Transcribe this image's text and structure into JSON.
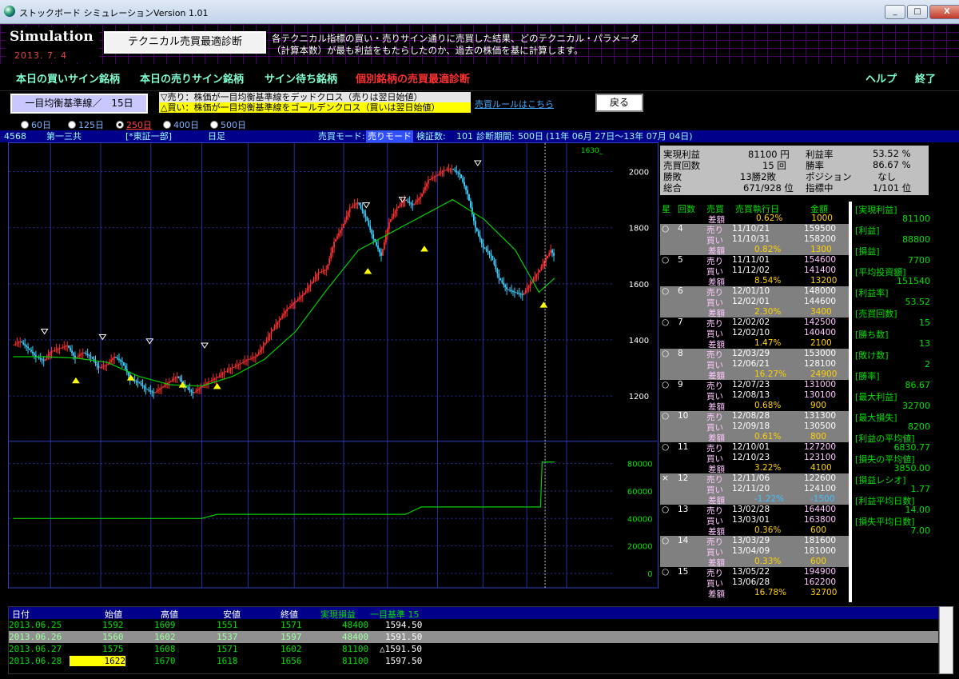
{
  "window": {
    "title": "ストックボード シミュレーションVersion 1.01",
    "min": "_",
    "max": "□",
    "close": "X"
  },
  "banner": {
    "logo": "Simulation",
    "date": "2013. 7. 4",
    "diag_button": "テクニカル売買最適診断",
    "description": "各テクニカル指標の買い・売りサイン通りに売買した結果、どのテクニカル・パラメータ（計算本数）が最も利益をもたらしたのか、過去の株価を基に計算します。"
  },
  "nav": {
    "buy": "本日の買いサイン銘柄",
    "sell": "本日の売りサイン銘柄",
    "wait": "サイン待ち銘柄",
    "optimal": "個別銘柄の売買最適診断",
    "help": "ヘルプ",
    "exit": "終了"
  },
  "tools": {
    "indicator": "一目均衡基準線／　15日",
    "sell_rule": "▽売り：株価が一目均衡基準線をデッドクロス（売りは翌日始値）",
    "buy_rule": "△買い：株価が一目均衡基準線をゴールデンクロス（買いは翌日始値）",
    "rule_link": "売買ルールはこちら",
    "back": "戻る"
  },
  "periods": [
    "60日",
    "125日",
    "250日",
    "400日",
    "500日"
  ],
  "selected_period": "250日",
  "info": {
    "code": "4568",
    "name": "第一三共",
    "market": "[*東証一部]",
    "ashi": "日足",
    "mode_label": "売買モード:",
    "mode": "売りモード",
    "count_label": "検証数:",
    "count": "101",
    "period_label": "診断期間:",
    "period": "500日",
    "range": "(11年 06月 27日～13年 07月 04日)"
  },
  "stats": {
    "jitsugen_label": "実現利益",
    "jitsugen": "81100 円",
    "rieki_rate_label": "利益率",
    "rieki_rate": "53.52 %",
    "count_label": "売買回数",
    "count": "15 回",
    "win_rate_label": "勝率",
    "win_rate": "86.67 %",
    "wl_label": "勝敗",
    "wl": "13勝2敗",
    "pos_label": "ポジション",
    "pos": "なし",
    "total_label": "総合",
    "total": "671/928 位",
    "index_label": "指標中",
    "index": "1/101 位"
  },
  "trade_header": {
    "star": "星",
    "no": "回数",
    "side": "売買",
    "date": "売買執行日",
    "amount": "金額"
  },
  "first_diff": {
    "label": "差額",
    "pct": "0.62%",
    "amt": "1000"
  },
  "trades": [
    {
      "mark": "○",
      "no": "4",
      "sell_date": "11/10/21",
      "sell_amt": "159500",
      "buy_date": "11/10/31",
      "buy_amt": "158200",
      "pct": "0.82%",
      "diff": "1300"
    },
    {
      "mark": "○",
      "no": "5",
      "sell_date": "11/11/01",
      "sell_amt": "154600",
      "buy_date": "11/12/02",
      "buy_amt": "141400",
      "pct": "8.54%",
      "diff": "13200"
    },
    {
      "mark": "○",
      "no": "6",
      "sell_date": "12/01/10",
      "sell_amt": "148000",
      "buy_date": "12/02/01",
      "buy_amt": "144600",
      "pct": "2.30%",
      "diff": "3400"
    },
    {
      "mark": "○",
      "no": "7",
      "sell_date": "12/02/02",
      "sell_amt": "142500",
      "buy_date": "12/02/10",
      "buy_amt": "140400",
      "pct": "1.47%",
      "diff": "2100"
    },
    {
      "mark": "○",
      "no": "8",
      "sell_date": "12/03/29",
      "sell_amt": "153000",
      "buy_date": "12/06/21",
      "buy_amt": "128100",
      "pct": "16.27%",
      "diff": "24900"
    },
    {
      "mark": "○",
      "no": "9",
      "sell_date": "12/07/23",
      "sell_amt": "131000",
      "buy_date": "12/08/13",
      "buy_amt": "130100",
      "pct": "0.68%",
      "diff": "900"
    },
    {
      "mark": "○",
      "no": "10",
      "sell_date": "12/08/28",
      "sell_amt": "131300",
      "buy_date": "12/09/18",
      "buy_amt": "130500",
      "pct": "0.61%",
      "diff": "800"
    },
    {
      "mark": "○",
      "no": "11",
      "sell_date": "12/10/01",
      "sell_amt": "127200",
      "buy_date": "12/10/23",
      "buy_amt": "123100",
      "pct": "3.22%",
      "diff": "4100"
    },
    {
      "mark": "×",
      "no": "12",
      "sell_date": "12/11/06",
      "sell_amt": "122600",
      "buy_date": "12/11/20",
      "buy_amt": "124100",
      "pct": "-1.22%",
      "diff": "-1500"
    },
    {
      "mark": "○",
      "no": "13",
      "sell_date": "13/02/28",
      "sell_amt": "164400",
      "buy_date": "13/03/01",
      "buy_amt": "163800",
      "pct": "0.36%",
      "diff": "600"
    },
    {
      "mark": "○",
      "no": "14",
      "sell_date": "13/03/29",
      "sell_amt": "181600",
      "buy_date": "13/04/09",
      "buy_amt": "181000",
      "pct": "0.33%",
      "diff": "600"
    },
    {
      "mark": "○",
      "no": "15",
      "sell_date": "13/05/22",
      "sell_amt": "194900",
      "buy_date": "13/06/28",
      "buy_amt": "162200",
      "pct": "16.78%",
      "diff": "32700"
    }
  ],
  "trade_words": {
    "sell": "売り",
    "buy": "買い",
    "diff": "差額"
  },
  "summary": [
    {
      "k": "[実現利益]",
      "v": "81100"
    },
    {
      "k": "[利益]",
      "v": "88800"
    },
    {
      "k": "[損益]",
      "v": "7700"
    },
    {
      "k": "[平均投資額]",
      "v": "151540"
    },
    {
      "k": "[利益率]",
      "v": "53.52"
    },
    {
      "k": "[売買回数]",
      "v": "15"
    },
    {
      "k": "[勝ち数]",
      "v": "13"
    },
    {
      "k": "[敗け数]",
      "v": "2"
    },
    {
      "k": "[勝率]",
      "v": "86.67"
    },
    {
      "k": "[最大利益]",
      "v": "32700"
    },
    {
      "k": "[最大損失]",
      "v": "8200"
    },
    {
      "k": "[利益の平均値]",
      "v": "6830.77"
    },
    {
      "k": "[損失の平均値]",
      "v": "3850.00"
    },
    {
      "k": "[損益レシオ]",
      "v": "1.77"
    },
    {
      "k": "[利益平均日数]",
      "v": "14.00"
    },
    {
      "k": "[損失平均日数]",
      "v": "7.00"
    }
  ],
  "table": {
    "headers": [
      "日付",
      "始値",
      "高値",
      "安値",
      "終値",
      "実現損益",
      "一目基準 15"
    ],
    "rows": [
      [
        "2013.06.25",
        "1592",
        "1609",
        "1551",
        "1571",
        "48400",
        "1594.50"
      ],
      [
        "2013.06.26",
        "1560",
        "1602",
        "1537",
        "1597",
        "48400",
        "1591.50"
      ],
      [
        "2013.06.27",
        "1575",
        "1608",
        "1571",
        "1602",
        "81100",
        "△1591.50"
      ],
      [
        "2013.06.28",
        "1622",
        "1670",
        "1618",
        "1656",
        "81100",
        "1597.50"
      ]
    ]
  },
  "chart_data": {
    "type": "candlestick",
    "price_axis": {
      "ticks": [
        "2000",
        "1800",
        "1600",
        "1400",
        "1200"
      ],
      "range": [
        1050,
        2090
      ]
    },
    "profit_axis": {
      "ticks": [
        "80000",
        "60000",
        "40000",
        "20000",
        "0"
      ],
      "range": [
        -3000,
        87000
      ]
    },
    "x_labels": [
      "7",
      "8",
      "9",
      "10",
      "11",
      "12",
      "13/1",
      "2",
      "3",
      "4",
      "5",
      "6",
      "7"
    ],
    "last_price_label": "1630_",
    "price_path": [
      [
        0,
        1380
      ],
      [
        5,
        1395
      ],
      [
        10,
        1370
      ],
      [
        15,
        1340
      ],
      [
        20,
        1325
      ],
      [
        25,
        1360
      ],
      [
        30,
        1370
      ],
      [
        35,
        1380
      ],
      [
        40,
        1335
      ],
      [
        45,
        1355
      ],
      [
        50,
        1340
      ],
      [
        55,
        1300
      ],
      [
        60,
        1310
      ],
      [
        65,
        1340
      ],
      [
        70,
        1320
      ],
      [
        75,
        1260
      ],
      [
        80,
        1250
      ],
      [
        85,
        1225
      ],
      [
        90,
        1210
      ],
      [
        95,
        1230
      ],
      [
        100,
        1250
      ],
      [
        105,
        1270
      ],
      [
        110,
        1235
      ],
      [
        115,
        1210
      ],
      [
        120,
        1230
      ],
      [
        125,
        1250
      ],
      [
        130,
        1265
      ],
      [
        135,
        1285
      ],
      [
        140,
        1300
      ],
      [
        145,
        1315
      ],
      [
        150,
        1330
      ],
      [
        155,
        1340
      ],
      [
        160,
        1380
      ],
      [
        165,
        1430
      ],
      [
        170,
        1470
      ],
      [
        175,
        1510
      ],
      [
        180,
        1535
      ],
      [
        185,
        1560
      ],
      [
        190,
        1600
      ],
      [
        195,
        1640
      ],
      [
        200,
        1650
      ],
      [
        205,
        1750
      ],
      [
        210,
        1800
      ],
      [
        215,
        1870
      ],
      [
        220,
        1890
      ],
      [
        225,
        1840
      ],
      [
        230,
        1760
      ],
      [
        235,
        1700
      ],
      [
        240,
        1820
      ],
      [
        245,
        1870
      ],
      [
        250,
        1900
      ],
      [
        255,
        1880
      ],
      [
        260,
        1910
      ],
      [
        265,
        1970
      ],
      [
        270,
        1985
      ],
      [
        275,
        2005
      ],
      [
        280,
        2010
      ],
      [
        285,
        1990
      ],
      [
        290,
        1920
      ],
      [
        295,
        1800
      ],
      [
        300,
        1730
      ],
      [
        305,
        1700
      ],
      [
        310,
        1620
      ],
      [
        315,
        1580
      ],
      [
        320,
        1570
      ],
      [
        325,
        1560
      ],
      [
        330,
        1600
      ],
      [
        335,
        1640
      ],
      [
        340,
        1690
      ],
      [
        343,
        1720
      ],
      [
        345,
        1700
      ]
    ],
    "kijun_path": [
      [
        0,
        1340
      ],
      [
        20,
        1340
      ],
      [
        40,
        1335
      ],
      [
        60,
        1320
      ],
      [
        80,
        1270
      ],
      [
        100,
        1240
      ],
      [
        120,
        1235
      ],
      [
        140,
        1270
      ],
      [
        160,
        1330
      ],
      [
        180,
        1430
      ],
      [
        200,
        1580
      ],
      [
        220,
        1720
      ],
      [
        240,
        1780
      ],
      [
        260,
        1840
      ],
      [
        280,
        1900
      ],
      [
        300,
        1830
      ],
      [
        320,
        1720
      ],
      [
        335,
        1570
      ],
      [
        345,
        1620
      ]
    ],
    "profit_path": [
      [
        0,
        40000
      ],
      [
        120,
        40000
      ],
      [
        130,
        43000
      ],
      [
        250,
        43000
      ],
      [
        260,
        48400
      ],
      [
        336,
        48400
      ],
      [
        337,
        81100
      ],
      [
        345,
        81100
      ]
    ],
    "sell_markers": [
      [
        20,
        1430
      ],
      [
        57,
        1410
      ],
      [
        87,
        1395
      ],
      [
        122,
        1380
      ],
      [
        225,
        1880
      ],
      [
        248,
        1900
      ],
      [
        296,
        2030
      ]
    ],
    "buy_markers": [
      [
        40,
        1255
      ],
      [
        75,
        1265
      ],
      [
        108,
        1240
      ],
      [
        130,
        1235
      ],
      [
        226,
        1645
      ],
      [
        262,
        1725
      ],
      [
        338,
        1525
      ]
    ]
  }
}
